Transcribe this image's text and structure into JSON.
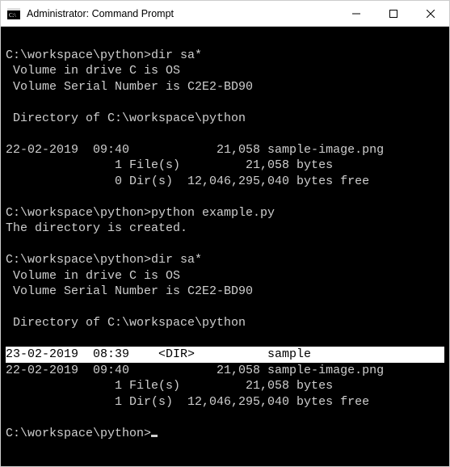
{
  "titlebar": {
    "icon_name": "cmd-icon",
    "title": "Administrator: Command Prompt"
  },
  "terminal": {
    "blocks": [
      {
        "kind": "blank"
      },
      {
        "kind": "line",
        "text": "C:\\workspace\\python>dir sa*"
      },
      {
        "kind": "line",
        "text": " Volume in drive C is OS"
      },
      {
        "kind": "line",
        "text": " Volume Serial Number is C2E2-BD90"
      },
      {
        "kind": "blank"
      },
      {
        "kind": "line",
        "text": " Directory of C:\\workspace\\python"
      },
      {
        "kind": "blank"
      },
      {
        "kind": "line",
        "text": "22-02-2019  09:40            21,058 sample-image.png"
      },
      {
        "kind": "line",
        "text": "               1 File(s)         21,058 bytes"
      },
      {
        "kind": "line",
        "text": "               0 Dir(s)  12,046,295,040 bytes free"
      },
      {
        "kind": "blank"
      },
      {
        "kind": "line",
        "text": "C:\\workspace\\python>python example.py"
      },
      {
        "kind": "line",
        "text": "The directory is created."
      },
      {
        "kind": "blank"
      },
      {
        "kind": "line",
        "text": "C:\\workspace\\python>dir sa*"
      },
      {
        "kind": "line",
        "text": " Volume in drive C is OS"
      },
      {
        "kind": "line",
        "text": " Volume Serial Number is C2E2-BD90"
      },
      {
        "kind": "blank"
      },
      {
        "kind": "line",
        "text": " Directory of C:\\workspace\\python"
      },
      {
        "kind": "blank"
      },
      {
        "kind": "highlight",
        "text": "23-02-2019  08:39    <DIR>          sample"
      },
      {
        "kind": "line",
        "text": "22-02-2019  09:40            21,058 sample-image.png"
      },
      {
        "kind": "line",
        "text": "               1 File(s)         21,058 bytes"
      },
      {
        "kind": "line",
        "text": "               1 Dir(s)  12,046,295,040 bytes free"
      },
      {
        "kind": "blank"
      },
      {
        "kind": "prompt",
        "text": "C:\\workspace\\python>"
      }
    ]
  }
}
